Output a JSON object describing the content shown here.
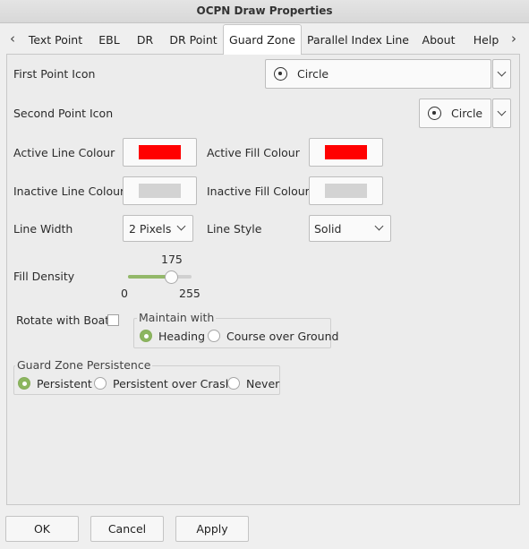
{
  "window": {
    "title": "OCPN Draw Properties"
  },
  "tabs": [
    {
      "label": "Text Point"
    },
    {
      "label": "EBL"
    },
    {
      "label": "DR"
    },
    {
      "label": "DR Point"
    },
    {
      "label": "Guard Zone",
      "active": true
    },
    {
      "label": "Parallel Index Line"
    },
    {
      "label": "About"
    },
    {
      "label": "Help"
    }
  ],
  "form": {
    "first_point_icon": {
      "label": "First Point Icon",
      "value": "Circle",
      "icon": "circle-dot-icon"
    },
    "second_point_icon": {
      "label": "Second Point Icon",
      "value": "Circle",
      "icon": "circle-dot-icon"
    },
    "active_line_colour": {
      "label": "Active Line Colour",
      "color": "#ff0000"
    },
    "active_fill_colour": {
      "label": "Active Fill Colour",
      "color": "#ff0000"
    },
    "inactive_line_colour": {
      "label": "Inactive Line Colour",
      "color": "#d3d3d3"
    },
    "inactive_fill_colour": {
      "label": "Inactive Fill Colour",
      "color": "#d3d3d3"
    },
    "line_width": {
      "label": "Line Width",
      "value": "2 Pixels"
    },
    "line_style": {
      "label": "Line Style",
      "value": "Solid"
    },
    "fill_density": {
      "label": "Fill Density",
      "value": "175",
      "min": "0",
      "max": "255"
    },
    "rotate_with_boat": {
      "label": "Rotate with Boat",
      "checked": false
    },
    "maintain_with": {
      "title": "Maintain with",
      "options": [
        {
          "label": "Heading",
          "selected": true
        },
        {
          "label": "Course over Ground",
          "selected": false
        }
      ]
    },
    "persistence": {
      "title": "Guard Zone Persistence",
      "options": [
        {
          "label": "Persistent",
          "selected": true
        },
        {
          "label": "Persistent over Crash",
          "selected": false
        },
        {
          "label": "Never",
          "selected": false
        }
      ]
    }
  },
  "buttons": {
    "ok": "OK",
    "cancel": "Cancel",
    "apply": "Apply"
  },
  "colors": {
    "accent": "#8cb65f"
  }
}
